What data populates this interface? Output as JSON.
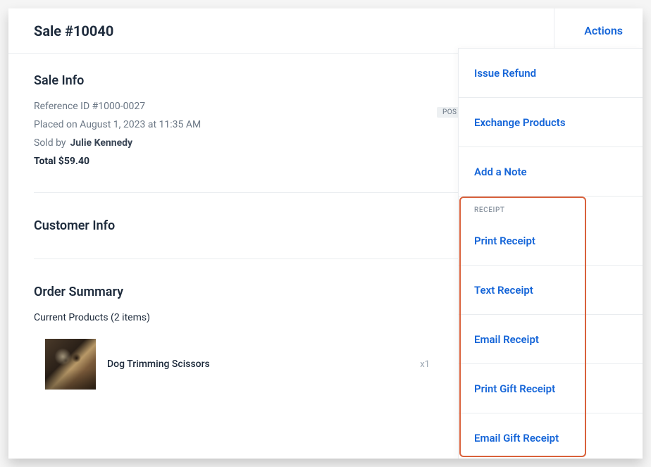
{
  "header": {
    "title": "Sale #10040",
    "actions_label": "Actions"
  },
  "sale_info": {
    "section_title": "Sale Info",
    "reference_label": "Reference ID #1000-0027",
    "placed_label": "Placed on August 1, 2023 at 11:35 AM",
    "sold_by_label": "Sold by",
    "sold_by_name": "Julie Kennedy",
    "total_label": "Total $59.40",
    "badge": "POS S"
  },
  "customer_info": {
    "section_title": "Customer Info"
  },
  "order_summary": {
    "section_title": "Order Summary",
    "current_products_label": "Current Products (2 items)",
    "items": [
      {
        "name": "Dog Trimming Scissors",
        "qty": "x1"
      }
    ]
  },
  "actions_menu": {
    "items": [
      {
        "label": "Issue Refund"
      },
      {
        "label": "Exchange Products"
      },
      {
        "label": "Add a Note"
      }
    ],
    "receipt_header": "RECEIPT",
    "receipt_items": [
      {
        "label": "Print Receipt"
      },
      {
        "label": "Text Receipt"
      },
      {
        "label": "Email Receipt"
      },
      {
        "label": "Print Gift Receipt"
      },
      {
        "label": "Email Gift Receipt"
      }
    ]
  }
}
